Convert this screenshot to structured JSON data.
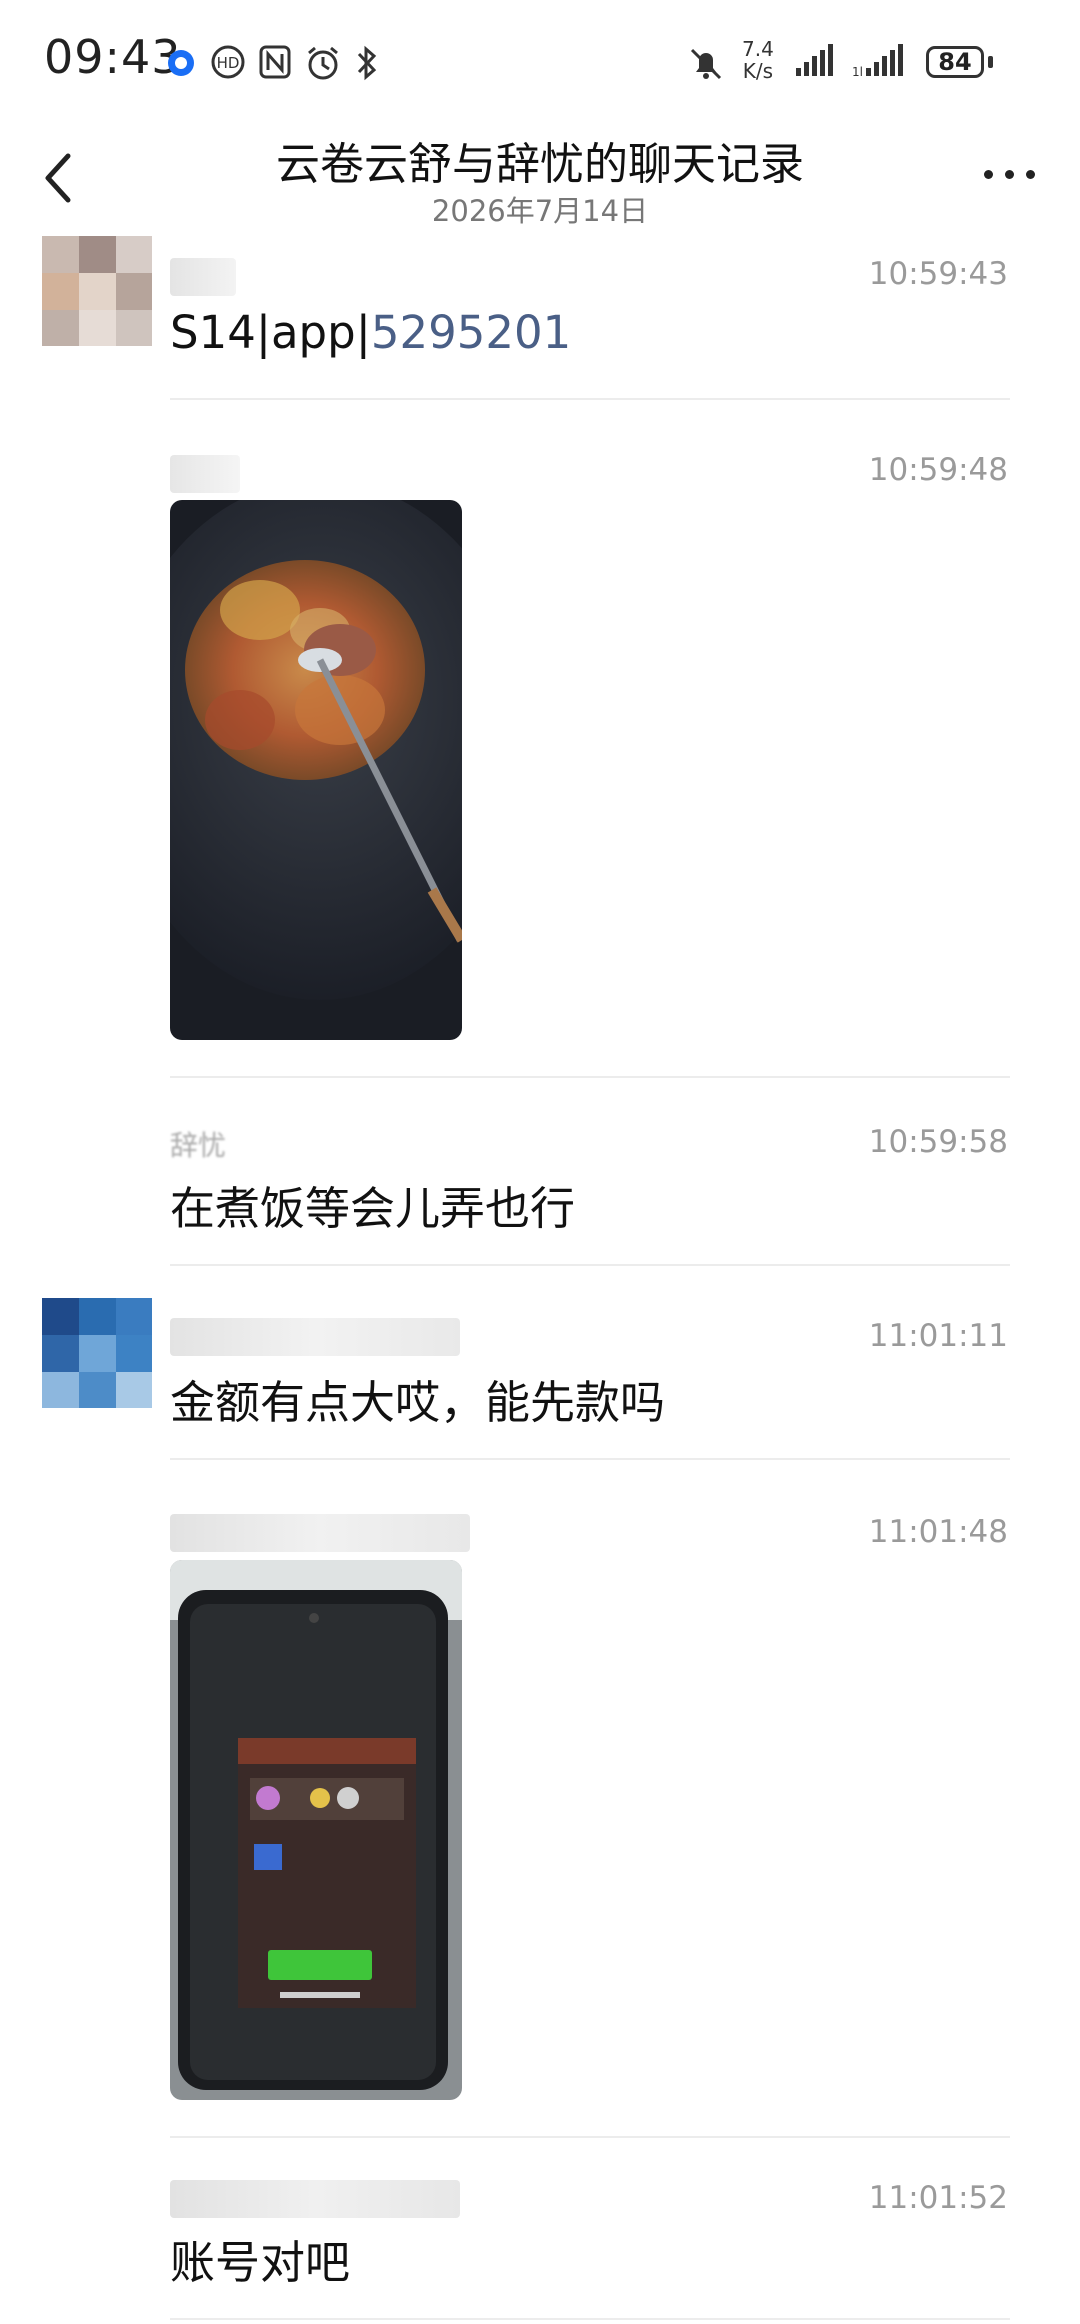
{
  "status_bar": {
    "time": "09:43",
    "net_speed_value": "7.4",
    "net_speed_unit": "K/s",
    "battery": "84"
  },
  "header": {
    "title": "云卷云舒与辞忧的聊天记录",
    "date": "2026年7月14日"
  },
  "messages": [
    {
      "timestamp": "10:59:43",
      "text_prefix": "S14|app|",
      "text_number": "5295201"
    },
    {
      "timestamp": "10:59:48"
    },
    {
      "timestamp": "10:59:58",
      "sender": "辞忧",
      "text": "在煮饭等会儿弄也行"
    },
    {
      "timestamp": "11:01:11",
      "text": "金额有点大哎，能先款吗"
    },
    {
      "timestamp": "11:01:48"
    },
    {
      "timestamp": "11:01:52",
      "text": "账号对吧"
    }
  ],
  "colors": {
    "link_number": "#4a5f86",
    "timestamp": "#9a9a9a",
    "divider": "#ececec"
  }
}
